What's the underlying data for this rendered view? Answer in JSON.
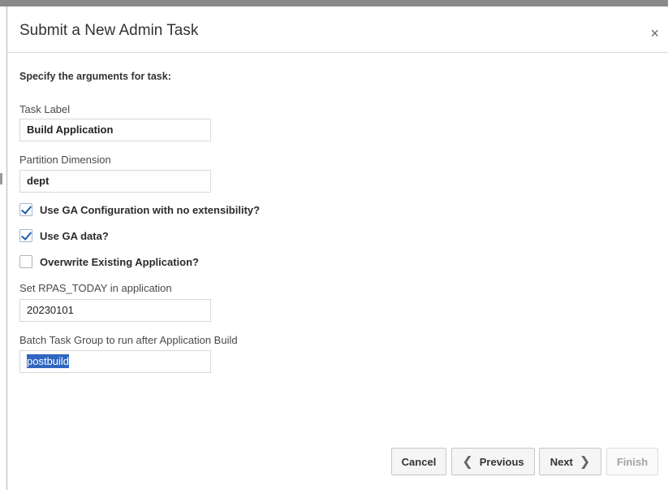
{
  "dialog": {
    "title": "Submit a New Admin Task",
    "close_glyph": "×",
    "instructions": "Specify the arguments for task:"
  },
  "fields": {
    "task_label": {
      "label": "Task Label",
      "value": "Build Application"
    },
    "partition_dimension": {
      "label": "Partition Dimension",
      "value": "dept"
    },
    "rpas_today": {
      "label": "Set RPAS_TODAY in application",
      "value": "20230101"
    },
    "batch_task_group": {
      "label": "Batch Task Group to run after Application Build",
      "value": "postbuild"
    }
  },
  "checkboxes": {
    "ga_configuration": {
      "label": "Use GA Configuration with no extensibility?",
      "checked": true
    },
    "ga_data": {
      "label": "Use GA data?",
      "checked": true
    },
    "overwrite": {
      "label": "Overwrite Existing Application?",
      "checked": false
    }
  },
  "buttons": {
    "cancel": "Cancel",
    "previous": "Previous",
    "previous_icon": "chevron-left-icon",
    "next": "Next",
    "next_icon": "chevron-right-icon",
    "finish": "Finish"
  },
  "colors": {
    "selection": "#2f66c0",
    "checkmark": "#1f5fa8"
  }
}
